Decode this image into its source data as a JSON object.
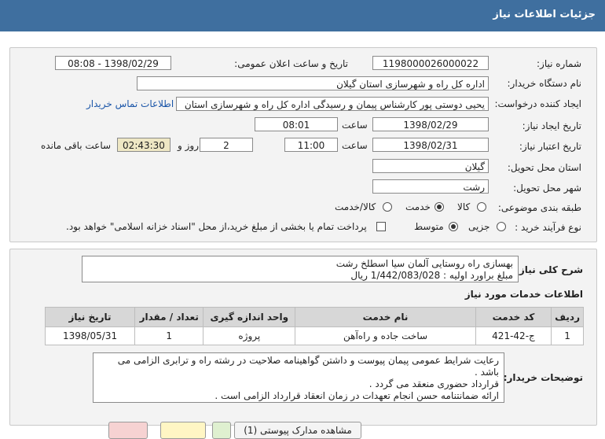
{
  "header": {
    "title": "جزئیات اطلاعات نیاز"
  },
  "form": {
    "need_number": {
      "label": "شماره نیاز:",
      "value": "1198000026000022"
    },
    "announce": {
      "label": "تاریخ و ساعت اعلان عمومی:",
      "value": "1398/02/29 - 08:08"
    },
    "buyer_org": {
      "label": "نام دستگاه خریدار:",
      "value": "اداره کل راه و شهرسازی استان گیلان"
    },
    "requester": {
      "label": "ایجاد کننده درخواست:",
      "value": "یحیی دوستی پور کارشناس پیمان و رسیدگی اداره کل راه و شهرسازی استان",
      "contact_link": "اطلاعات تماس خریدار"
    },
    "created": {
      "label": "تاریخ ایجاد نیاز:",
      "date": "1398/02/29",
      "time_label": "ساعت",
      "time": "08:01"
    },
    "validity": {
      "label": "تاریخ اعتبار نیاز:",
      "date": "1398/02/31",
      "time_label": "ساعت",
      "time": "11:00",
      "days": "2",
      "days_label": "روز و",
      "remaining": "02:43:30",
      "remaining_label": "ساعت باقی مانده"
    },
    "province": {
      "label": "استان محل تحویل:",
      "value": "گیلان"
    },
    "city": {
      "label": "شهر محل تحویل:",
      "value": "رشت"
    },
    "category": {
      "label": "طبقه بندی موضوعی:",
      "options": [
        "کالا",
        "خدمت",
        "کالا/خدمت"
      ],
      "selected": "خدمت"
    },
    "process": {
      "label": "نوع فرآیند خرید :",
      "options": [
        "جزیی",
        "متوسط"
      ],
      "selected": "متوسط",
      "payment_note": "پرداخت تمام یا بخشی از مبلغ خرید،از محل \"اسناد خزانه اسلامی\" خواهد بود."
    }
  },
  "summary": {
    "label": "شرح کلی نیاز:",
    "line1": "بهسازی راه روستایی آلمان سیا اسطلخ رشت",
    "line2": "مبلغ براورد اولیه : 1/442/083/028 ریال"
  },
  "services": {
    "title": "اطلاعات خدمات مورد نیاز",
    "columns": [
      "ردیف",
      "کد خدمت",
      "نام خدمت",
      "واحد اندازه گیری",
      "تعداد / مقدار",
      "تاریخ نیاز"
    ],
    "rows": [
      [
        "1",
        "ج-42-421",
        "ساخت جاده و راه‌آهن",
        "پروژه",
        "1",
        "1398/05/31"
      ]
    ]
  },
  "notes": {
    "label": "توضیحات خریدار:",
    "lines": [
      "رعایت شرایط عمومی پیمان پیوست و داشتن گواهینامه صلاحیت در رشته راه و ترابری الزامی می باشد .",
      "قرارداد حضوری منعقد می گردد .",
      "ارائه ضمانتنامه حسن انجام تعهدات در زمان انعقاد قرارداد الزامی است ."
    ]
  },
  "buttons": {
    "view_docs": "مشاهده مدارک پیوستی (1)"
  }
}
